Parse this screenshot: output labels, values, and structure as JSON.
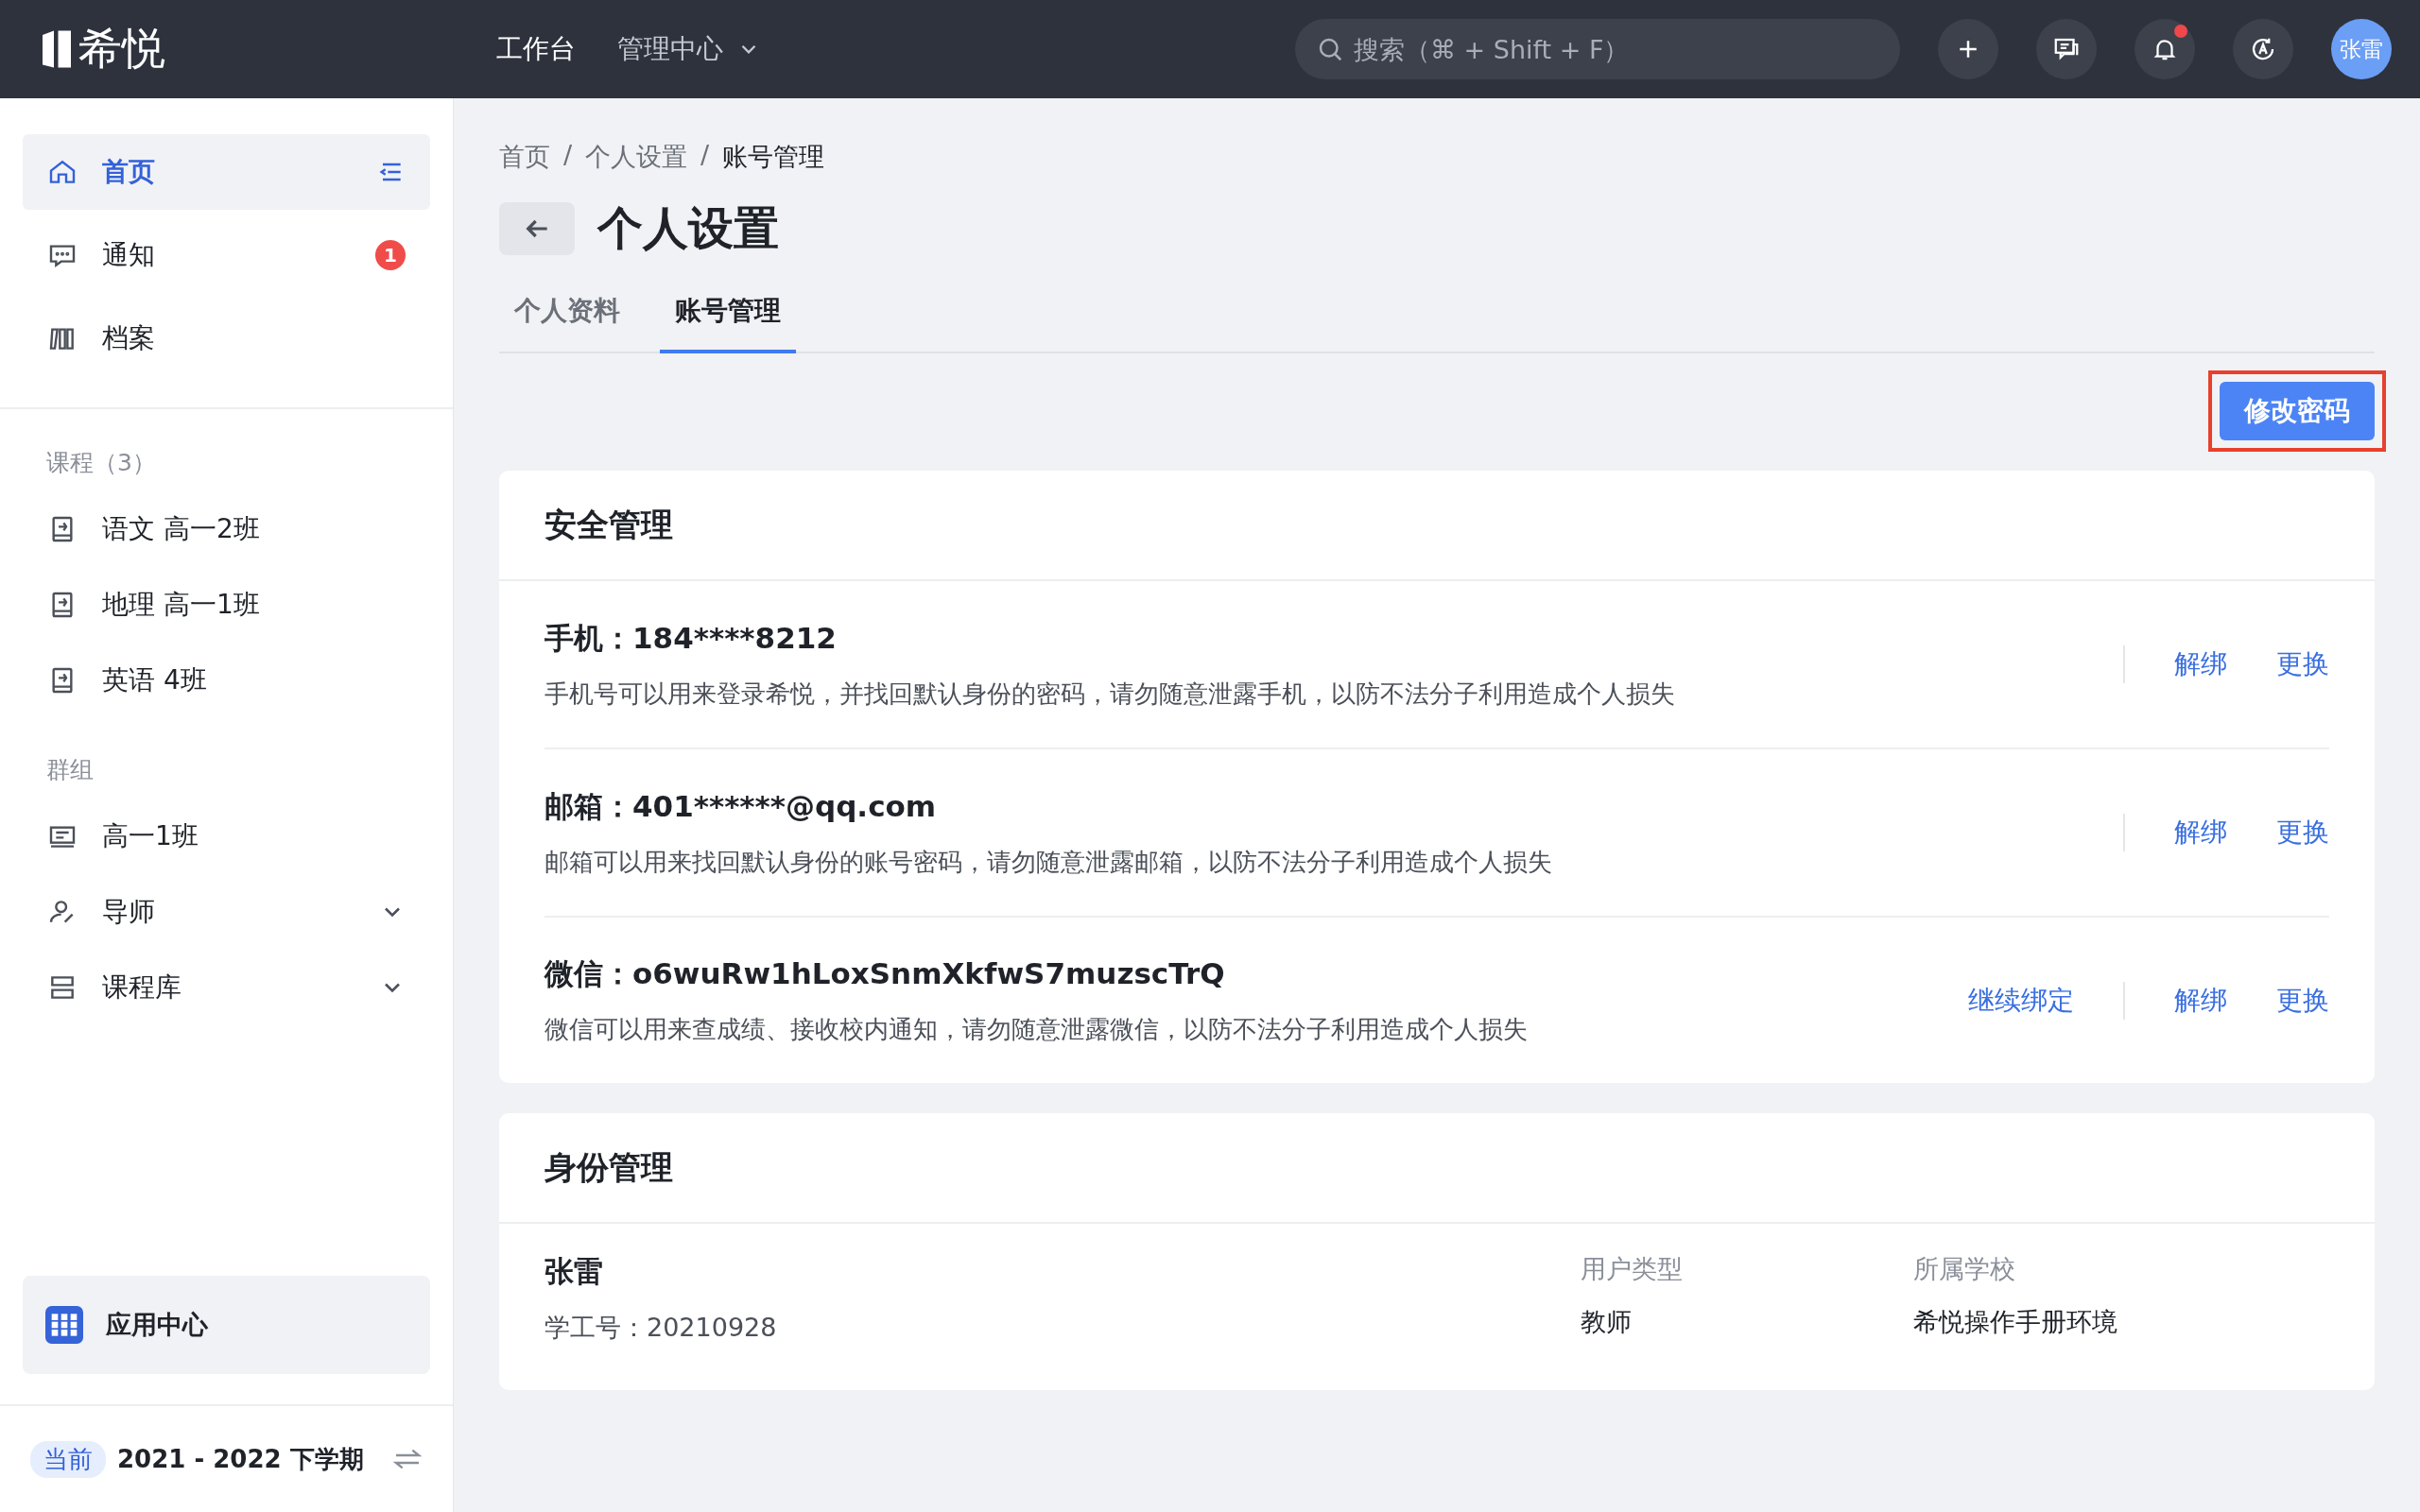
{
  "topbar": {
    "logo": "希悦",
    "nav": [
      {
        "label": "工作台",
        "selected": true,
        "dropdown": false
      },
      {
        "label": "管理中心",
        "selected": false,
        "dropdown": true
      }
    ],
    "search": {
      "placeholder": "搜索（⌘ + Shift + F）"
    },
    "notifications_unread": true,
    "avatar": "张雷"
  },
  "sidebar": {
    "main": [
      {
        "label": "首页",
        "selected": true
      },
      {
        "label": "通知",
        "selected": false,
        "badge": "1"
      },
      {
        "label": "档案",
        "selected": false
      }
    ],
    "courses": {
      "title": "课程（3）",
      "items": [
        {
          "label": "语文 高一2班",
          "selected": false
        },
        {
          "label": "地理 高一1班",
          "selected": false
        },
        {
          "label": "英语 4班",
          "selected": false
        }
      ]
    },
    "groups": {
      "title": "群组",
      "items": [
        {
          "label": "高一1班",
          "selected": false,
          "kind": "item"
        },
        {
          "label": "导师",
          "selected": false,
          "kind": "folder",
          "expanded": false
        },
        {
          "label": "课程库",
          "selected": false,
          "kind": "folder",
          "expanded": false
        }
      ]
    },
    "app_center": "应用中心",
    "term": {
      "tag": "当前",
      "label": "2021 - 2022 下学期"
    }
  },
  "breadcrumb": [
    {
      "label": "首页",
      "current": false
    },
    {
      "label": "个人设置",
      "current": false
    },
    {
      "label": "账号管理",
      "current": true
    }
  ],
  "separator": "/",
  "page_title": "个人设置",
  "tabs": [
    {
      "label": "个人资料",
      "selected": false
    },
    {
      "label": "账号管理",
      "selected": true
    }
  ],
  "primary_button": {
    "label": "修改密码",
    "highlighted": true
  },
  "security": {
    "title": "安全管理",
    "rows": [
      {
        "label": "手机：",
        "value": "184****8212",
        "description": "手机号可以用来登录希悦，并找回默认身份的密码，请勿随意泄露手机，以防不法分子利用造成个人损失",
        "actions": [
          "解绑",
          "更换"
        ]
      },
      {
        "label": "邮箱：",
        "value": "401******@qq.com",
        "description": "邮箱可以用来找回默认身份的账号密码，请勿随意泄露邮箱，以防不法分子利用造成个人损失",
        "actions": [
          "解绑",
          "更换"
        ]
      },
      {
        "label": "微信：",
        "value": "o6wuRw1hLoxSnmXkfwS7muzscTrQ",
        "description": "微信可以用来查成绩、接收校内通知，请勿随意泄露微信，以防不法分子利用造成个人损失",
        "extra_action": "继续绑定",
        "actions": [
          "解绑",
          "更换"
        ]
      }
    ]
  },
  "identity": {
    "title": "身份管理",
    "name": "张雷",
    "id_line": "学工号：20210928",
    "columns": [
      {
        "label": "用户类型",
        "value": "教师"
      },
      {
        "label": "所属学校",
        "value": "希悦操作手册环境"
      }
    ]
  }
}
